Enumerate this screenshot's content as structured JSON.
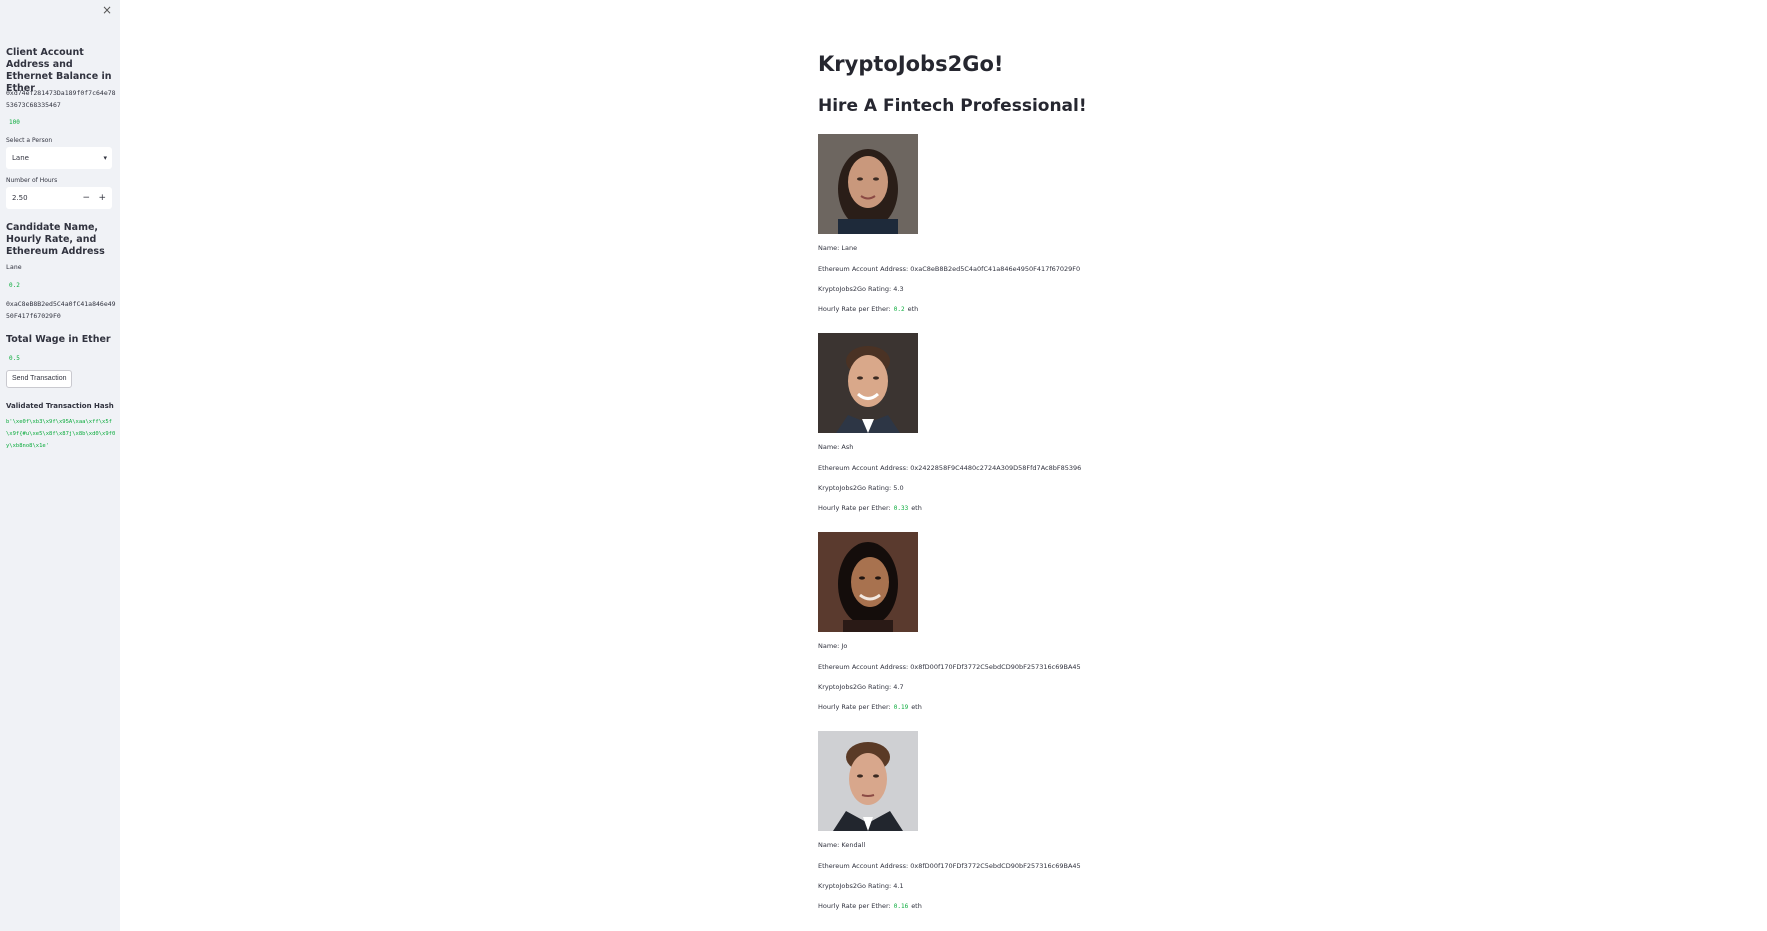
{
  "sidebar": {
    "close_icon": "×",
    "account_header": "Client Account Address and Ethernet Balance in Ether",
    "account_address": "0xd74ef281473Da189f0f7c64e7853673C68335467",
    "balance": "100",
    "select_label": "Select a Person",
    "selected_person": "Lane",
    "hours_label": "Number of Hours",
    "hours_value": "2.50",
    "candidate_header": "Candidate Name, Hourly Rate, and Ethereum Address",
    "candidate_name": "Lane",
    "candidate_rate": "0.2",
    "candidate_address": "0xaC8eB8B2ed5C4a0fC41a846e4950F417f67029F0",
    "total_wage_header": "Total Wage in Ether",
    "total_wage": "0.5",
    "send_button": "Send Transaction",
    "hash_header": "Validated Transaction Hash",
    "hash_value": "b'\\xe0f\\xb3\\x9f\\x95A\\xaa\\xff\\x5f\\x9f{#u\\xe5\\x8f\\x87j\\x8b\\xd0\\x9f0y\\xb8no8\\x1e'"
  },
  "main": {
    "title": "KryptoJobs2Go!",
    "subtitle": "Hire A Fintech Professional!",
    "candidates": [
      {
        "name_line": "Name: Lane",
        "address_line": "Ethereum Account Address: 0xaC8eB8B2ed5C4a0fC41a846e4950F417f67029F0",
        "rating_line": "KryptoJobs2Go Rating: 4.3",
        "rate_prefix": "Hourly Rate per Ether:",
        "rate_value": "0.2",
        "rate_suffix": "eth"
      },
      {
        "name_line": "Name: Ash",
        "address_line": "Ethereum Account Address: 0x2422858F9C4480c2724A309D58Ffd7Ac8bF85396",
        "rating_line": "KryptoJobs2Go Rating: 5.0",
        "rate_prefix": "Hourly Rate per Ether:",
        "rate_value": "0.33",
        "rate_suffix": "eth"
      },
      {
        "name_line": "Name: Jo",
        "address_line": "Ethereum Account Address: 0x8fD00f170FDf3772C5ebdCD90bF257316c69BA45",
        "rating_line": "KryptoJobs2Go Rating: 4.7",
        "rate_prefix": "Hourly Rate per Ether:",
        "rate_value": "0.19",
        "rate_suffix": "eth"
      },
      {
        "name_line": "Name: Kendall",
        "address_line": "Ethereum Account Address: 0x8fD00f170FDf3772C5ebdCD90bF257316c69BA45",
        "rating_line": "KryptoJobs2Go Rating: 4.1",
        "rate_prefix": "Hourly Rate per Ether:",
        "rate_value": "0.16",
        "rate_suffix": "eth"
      }
    ]
  }
}
